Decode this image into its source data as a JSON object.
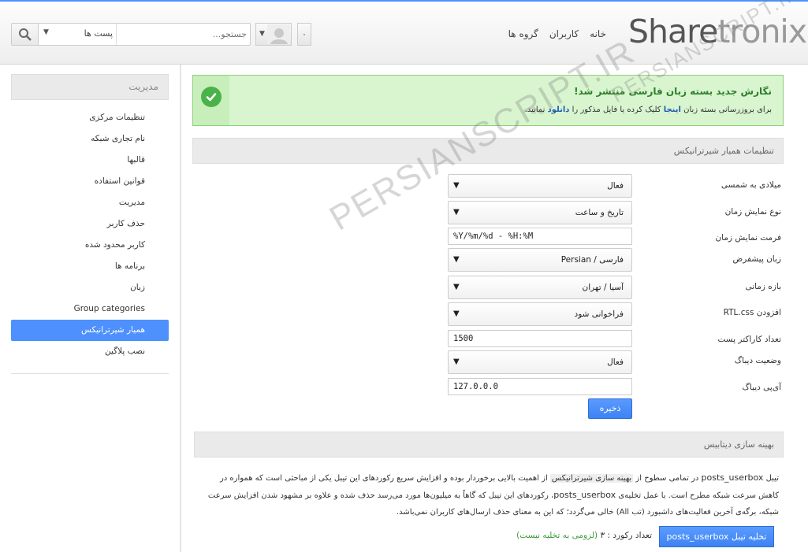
{
  "header": {
    "logo_a": "Share",
    "logo_b": "tronix",
    "nav": [
      "خانه",
      "کاربران",
      "گروه ها"
    ],
    "search_placeholder": "جستجو...",
    "search_scope": "پست ها",
    "notif_count": "۰"
  },
  "sidebar": {
    "title": "مدیریت",
    "items": [
      {
        "label": "تنظیمات مرکزی"
      },
      {
        "label": "نام تجاری شبکه"
      },
      {
        "label": "قالبها"
      },
      {
        "label": "قوانین استفاده"
      },
      {
        "label": "مدیریت"
      },
      {
        "label": "حذف کاربر"
      },
      {
        "label": "کاربر محدود شده"
      },
      {
        "label": "برنامه ها"
      },
      {
        "label": "زبان"
      },
      {
        "label": "Group categories"
      },
      {
        "label": "همیار شیرترانیکس"
      },
      {
        "label": "نصب پلاگین"
      }
    ],
    "active_index": 10
  },
  "alert": {
    "title": "نگارش جدید بسته زبان فارسی منتشر شد!",
    "text_pre": "برای بروزرسانی بسته زبان",
    "link1": "اینجا",
    "text_mid": "کلیک کرده یا فایل مذکور را",
    "link2": "دانلود",
    "text_post": "نمایید."
  },
  "settings": {
    "title": "تنظیمات همیار شیرترانیکس",
    "fields": {
      "gregorian": {
        "label": "میلادی به شمسی",
        "value": "فعال"
      },
      "time_type": {
        "label": "نوع نمایش زمان",
        "value": "تاریخ و ساعت"
      },
      "time_format": {
        "label": "فرمت نمایش زمان",
        "value": "%Y/%m/%d - %H:%M"
      },
      "default_lang": {
        "label": "زبان پیشفرض",
        "value": "فارسی / Persian"
      },
      "timezone": {
        "label": "بازه زمانی",
        "value": "آسیا / تهران"
      },
      "rtl_css": {
        "label": "افزودن RTL.css",
        "value": "فراخوانی شود"
      },
      "post_chars": {
        "label": "تعداد کاراکتر پست",
        "value": "1500"
      },
      "debug": {
        "label": "وضعیت دیباگ",
        "value": "فعال"
      },
      "debug_ip": {
        "label": "آی‌پی دیباگ",
        "value": "127.0.0.0"
      }
    },
    "save_label": "ذخیره"
  },
  "db": {
    "title": "بهینه سازی دیتابیس",
    "para1_a": "تیبل",
    "table_name": "posts_userbox",
    "para1_b": "در تمامی سطوح از",
    "highlight": "بهینه سازی شیرترانیکس",
    "para1_c": "از اهمیت بالایی برخوردار بوده و افزایش سریع رکوردهای این تیبل یکی از مباحثی است که همواره در کاهش سرعت شبکه مطرح است. با عمل تخلیه‌ی",
    "para1_d": "، رکوردهای این تیبل که گاهاً به میلیون‌ها مورد می‌رسد حذف شده و علاوه بر مشهود شدن افزایش سرعت شبکه، برگه‌ی آخرین فعالیت‌های داشبورد (تب All) خالی می‌گردد؛ که این به معنای حذف ارسال‌های کاربران نمی‌باشد.",
    "empty_btn_a": "تخلیه تیبل",
    "empty_btn_b": "posts_userbox",
    "rec_label": "تعداد رکورد : ۳",
    "rec_note": "(لزومی به تخلیه نیست)"
  },
  "watermark": "PERSIANSCRIPT.IR"
}
